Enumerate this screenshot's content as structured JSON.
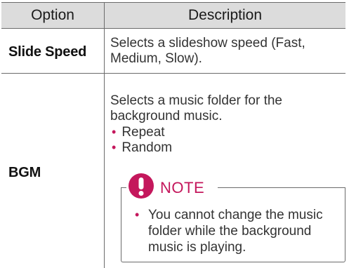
{
  "table": {
    "headers": {
      "option": "Option",
      "description": "Description"
    },
    "rows": [
      {
        "option": "Slide Speed",
        "description": "Selects a slideshow speed (Fast, Medium, Slow)."
      },
      {
        "option": "BGM",
        "description": "Selects a music folder for the background music.",
        "bullets": [
          "Repeat",
          "Random"
        ],
        "note": {
          "label": "NOTE",
          "items": [
            "You cannot change the music folder while the background music is playing."
          ]
        }
      }
    ]
  },
  "colors": {
    "accent": "#c4175c",
    "header_bg": "#dcdcdc",
    "rule": "#6b6b6b"
  },
  "icons": {
    "note": "exclamation-circle-icon",
    "bullet": "bullet-dot"
  }
}
